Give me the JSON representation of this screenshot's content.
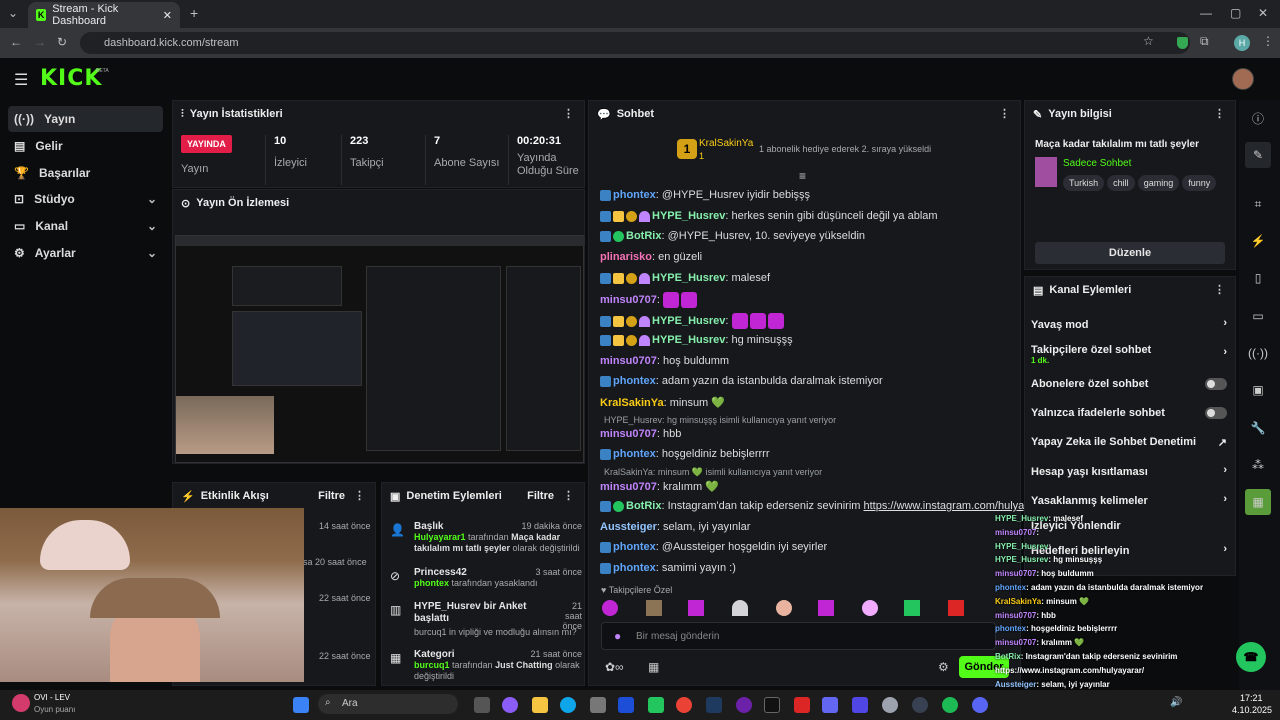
{
  "browser": {
    "tab_title": "Stream - Kick Dashboard",
    "url": "dashboard.kick.com/stream",
    "profile_initial": "H"
  },
  "app": {
    "logo": "KICK",
    "logo_beta": "BETA"
  },
  "sidebar": {
    "items": [
      {
        "label": "Yayın",
        "active": true
      },
      {
        "label": "Gelir"
      },
      {
        "label": "Başarılar"
      },
      {
        "label": "Stüdyo",
        "expandable": true
      },
      {
        "label": "Kanal",
        "expandable": true
      },
      {
        "label": "Ayarlar",
        "expandable": true
      }
    ]
  },
  "stats": {
    "title": "Yayın İstatistikleri",
    "live_label": "YAYINDA",
    "live_sub": "Yayın",
    "viewers": {
      "value": "10",
      "label": "İzleyici"
    },
    "followers": {
      "value": "223",
      "label": "Takipçi"
    },
    "subs": {
      "value": "7",
      "label": "Abone Sayısı"
    },
    "uptime": {
      "value": "00:20:31",
      "label": "Yayında Olduğu Süre"
    }
  },
  "preview": {
    "title": "Yayın Ön İzlemesi"
  },
  "activity": {
    "title": "Etkinlik Akışı",
    "filter": "Filtre",
    "times": [
      "14 saat önce",
      "20 saat önce",
      "22 saat önce",
      "22 saat önce"
    ],
    "partial": "sa"
  },
  "moderation": {
    "title": "Denetim Eylemleri",
    "filter": "Filtre",
    "items": [
      {
        "title": "Başlık",
        "time": "19 dakika önce",
        "user": "Hulyayarar1",
        "rest": " tarafından ",
        "bold": "Maça kadar takılalım mı tatlı şeyler",
        "tail": " olarak değiştirildi"
      },
      {
        "title": "Princess42",
        "time": "3 saat önce",
        "user": "phontex",
        "rest": " tarafından yasaklandı"
      },
      {
        "title": "HYPE_Husrev bir Anket başlattı",
        "time": "21 saat önce",
        "user": "",
        "rest": "burcuq1 in vipliği ve modluğu alınsın mı?"
      },
      {
        "title": "Kategori",
        "time": "21 saat önce",
        "user": "burcuq1",
        "rest": " tarafından ",
        "bold": "Just Chatting",
        "tail": " olarak değiştirildi"
      }
    ]
  },
  "chat": {
    "title": "Sohbet",
    "pinned_user": "KralSakinYa",
    "pinned_count": "1",
    "pinned_msg": "1 abonelik hediye ederek 2. sıraya yükseldi",
    "lines": [
      {
        "user": "phontex",
        "color": "#60a5fa",
        "badges": [
          "blue"
        ],
        "msg": "@HYPE_Husrev iyidir bebişşş"
      },
      {
        "user": "HYPE_Husrev",
        "color": "#86efac",
        "badges": [
          "blue",
          "crown",
          "one",
          "heart"
        ],
        "msg": "herkes senin gibi düşünceli değil ya ablam"
      },
      {
        "user": "BotRix",
        "color": "#86efac",
        "badges": [
          "blue",
          "bot"
        ],
        "msg": "@HYPE_Husrev, 10. seviyeye yükseldin"
      },
      {
        "user": "plinarisko",
        "color": "#f472b6",
        "badges": [],
        "msg": "en güzeli"
      },
      {
        "user": "HYPE_Husrev",
        "color": "#86efac",
        "badges": [
          "blue",
          "crown",
          "one",
          "heart"
        ],
        "msg": "malesef"
      },
      {
        "user": "minsu0707",
        "color": "#c084fc",
        "badges": [],
        "msg": "",
        "emotes": 2
      },
      {
        "user": "HYPE_Husrev",
        "color": "#86efac",
        "badges": [
          "blue",
          "crown",
          "one",
          "heart"
        ],
        "msg": "",
        "emotes": 3
      },
      {
        "user": "HYPE_Husrev",
        "color": "#86efac",
        "badges": [
          "blue",
          "crown",
          "one",
          "heart"
        ],
        "msg": "hg minsuşşş"
      },
      {
        "user": "minsu0707",
        "color": "#c084fc",
        "badges": [],
        "msg": "hoş buldumm"
      },
      {
        "user": "phontex",
        "color": "#60a5fa",
        "badges": [
          "blue"
        ],
        "msg": "adam yazın da istanbulda daralmak istemiyor"
      },
      {
        "user": "KralSakinYa",
        "color": "#facc15",
        "badges": [],
        "msg": "minsum 💚"
      },
      {
        "reply": "HYPE_Husrev: hg minsuşşş isimli kullanıcıya yanıt veriyor"
      },
      {
        "user": "minsu0707",
        "color": "#c084fc",
        "badges": [],
        "msg": "hbb"
      },
      {
        "user": "phontex",
        "color": "#60a5fa",
        "badges": [
          "blue"
        ],
        "msg": "hoşgeldiniz bebişlerrrr"
      },
      {
        "reply": "KralSakinYa: minsum 💚 isimli kullanıcıya yanıt veriyor"
      },
      {
        "user": "minsu0707",
        "color": "#c084fc",
        "badges": [],
        "msg": "kralımm 💚"
      },
      {
        "user": "BotRix",
        "color": "#86efac",
        "badges": [
          "blue",
          "bot"
        ],
        "msg": "Instagram'dan takip ederseniz sevinirim ",
        "link": "https://www.instagram.com/hulyayarar/"
      },
      {
        "user": "Aussteiger",
        "color": "#93c5fd",
        "badges": [],
        "msg": "selam, iyi yayınlar"
      },
      {
        "user": "phontex",
        "color": "#60a5fa",
        "badges": [
          "blue"
        ],
        "msg": "@Aussteiger hoşgeldin iyi seyirler"
      },
      {
        "user": "phontex",
        "color": "#60a5fa",
        "badges": [
          "blue"
        ],
        "msg": "samimi yayın :)"
      }
    ],
    "followers_only": "Takipçilere Özel",
    "input_placeholder": "Bir mesaj gönderin",
    "send": "Gönder"
  },
  "stream_info": {
    "title": "Yayın bilgisi",
    "stream_title": "Maça kadar takılalım mı tatlı şeyler",
    "category": "Sadece Sohbet",
    "tags": [
      "Turkish",
      "chill",
      "gaming",
      "funny"
    ],
    "edit": "Düzenle"
  },
  "channel_actions": {
    "title": "Kanal Eylemleri",
    "items": [
      {
        "label": "Yavaş mod",
        "type": "arrow"
      },
      {
        "label": "Takipçilere özel sohbet",
        "sub": "1 dk.",
        "type": "arrow"
      },
      {
        "label": "Abonelere özel sohbet",
        "type": "toggle"
      },
      {
        "label": "Yalnızca ifadelerle sohbet",
        "type": "toggle"
      },
      {
        "label": "Yapay Zeka ile Sohbet Denetimi",
        "type": "ext"
      },
      {
        "label": "Hesap yaşı kısıtlaması",
        "type": "arrow"
      },
      {
        "label": "Yasaklanmış kelimeler",
        "type": "arrow"
      },
      {
        "label": "İzleyici Yönlendir",
        "type": "arrow"
      },
      {
        "label": "Hedefleri belirleyin",
        "type": "arrow"
      }
    ]
  },
  "overlay_chat": [
    {
      "u": "HYPE_Husrev",
      "c": "#86efac",
      "m": ": malesef"
    },
    {
      "u": "minsu0707",
      "c": "#c084fc",
      "m": ":"
    },
    {
      "u": "HYPE_Husrev",
      "c": "#86efac",
      "m": ":"
    },
    {
      "u": "HYPE_Husrev",
      "c": "#86efac",
      "m": ": hg minsuşşş"
    },
    {
      "u": "minsu0707",
      "c": "#c084fc",
      "m": ": hoş buldumm"
    },
    {
      "u": "phontex",
      "c": "#60a5fa",
      "m": ": adam yazın da istanbulda daralmak istemiyor"
    },
    {
      "u": "KralSakinYa",
      "c": "#facc15",
      "m": ": minsum 💚"
    },
    {
      "u": "minsu0707",
      "c": "#c084fc",
      "m": ": hbb"
    },
    {
      "u": "phontex",
      "c": "#60a5fa",
      "m": ": hoşgeldiniz bebişlerrrr"
    },
    {
      "u": "minsu0707",
      "c": "#c084fc",
      "m": ": kralımm 💚"
    },
    {
      "u": "BotRix",
      "c": "#86efac",
      "m": ": Instagram'dan takip ederseniz sevinirim"
    },
    {
      "u": "",
      "c": "#fff",
      "m": "https://www.instagram.com/hulyayarar/"
    },
    {
      "u": "Aussteiger",
      "c": "#93c5fd",
      "m": ": selam, iyi yayınlar"
    },
    {
      "u": "phontex",
      "c": "#60a5fa",
      "m": ": @Aussteiger hoşgeldin iyi seyirler"
    },
    {
      "u": "phontex",
      "c": "#60a5fa",
      "m": ": samimi yayın :)"
    }
  ],
  "taskbar": {
    "media_title": "OVI - LEV",
    "media_sub": "Oyun puanı",
    "search": "Ara",
    "time": "17:21",
    "date": "4.10.2025"
  }
}
